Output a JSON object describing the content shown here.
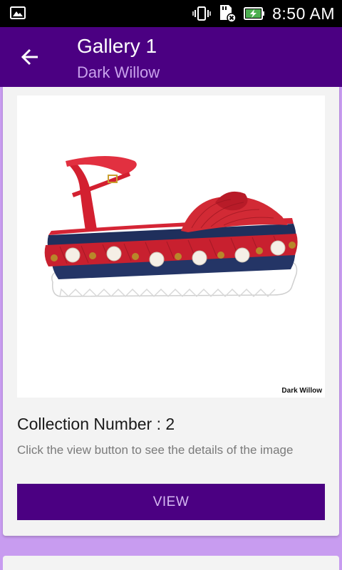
{
  "status_bar": {
    "time": "8:50 AM",
    "icons": [
      "image-notification-icon",
      "vibrate-icon",
      "sd-card-error-icon",
      "battery-charging-icon"
    ]
  },
  "app_bar": {
    "title": "Gallery 1",
    "subtitle": "Dark Willow",
    "back_icon": "arrow-back-icon"
  },
  "card": {
    "image_watermark": "Dark Willow",
    "title": "Collection Number : 2",
    "description": "Click the view button to see the details of the image",
    "button_label": "VIEW"
  },
  "colors": {
    "primary": "#4b0082",
    "background": "#c89cf0",
    "subtitle": "#c9a2ec",
    "button_text": "#d6b8f2"
  }
}
